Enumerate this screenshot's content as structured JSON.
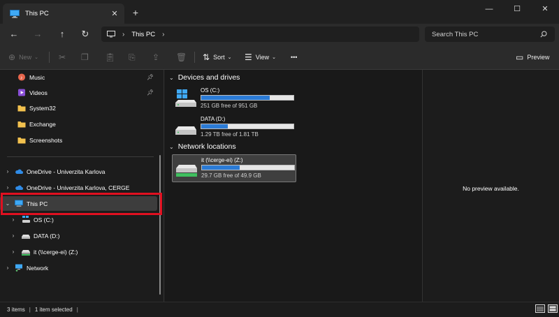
{
  "tab": {
    "title": "This PC",
    "close": "✕",
    "new_tab": "+"
  },
  "window_controls": {
    "minimize": "—",
    "maximize": "☐",
    "close": "✕"
  },
  "nav": {
    "back": "←",
    "forward": "→",
    "up": "↑",
    "refresh": "↻"
  },
  "address": {
    "separator": "›",
    "crumb": "This PC"
  },
  "search": {
    "placeholder": "Search This PC",
    "icon": "search-icon"
  },
  "toolbar": {
    "new_label": "New",
    "sort_label": "Sort",
    "view_label": "View",
    "more": "•••",
    "preview_label": "Preview"
  },
  "sidebar": {
    "quick_access": [
      {
        "label": "Music",
        "pinned": true,
        "icon": "music-icon"
      },
      {
        "label": "Videos",
        "pinned": true,
        "icon": "videos-icon"
      },
      {
        "label": "System32",
        "pinned": false,
        "icon": "folder-icon"
      },
      {
        "label": "Exchange",
        "pinned": false,
        "icon": "folder-icon"
      },
      {
        "label": "Screenshots",
        "pinned": false,
        "icon": "folder-icon"
      }
    ],
    "onedrive": [
      {
        "label": "OneDrive - Univerzita Karlova"
      },
      {
        "label": "OneDrive - Univerzita Karlova, CERGE"
      }
    ],
    "this_pc": {
      "label": "This PC"
    },
    "drives": [
      {
        "label": "OS (C:)"
      },
      {
        "label": "DATA (D:)"
      },
      {
        "label": "it (\\\\cerge-ei) (Z:)"
      }
    ],
    "network": {
      "label": "Network"
    }
  },
  "main": {
    "devices_header": "Devices and drives",
    "network_header": "Network locations",
    "drives": [
      {
        "name": "OS (C:)",
        "free": "251 GB free of 951 GB",
        "used_fraction": 0.74
      },
      {
        "name": "DATA (D:)",
        "free": "1.29 TB free of 1.81 TB",
        "used_fraction": 0.29
      },
      {
        "name": "it (\\\\cerge-ei) (Z:)",
        "free": "29.7 GB free of 49.9 GB",
        "used_fraction": 0.41
      }
    ]
  },
  "preview": {
    "empty_text": "No preview available."
  },
  "status": {
    "items": "3 items",
    "selected": "1 item selected",
    "sep": "|"
  },
  "colors": {
    "accent": "#2b7bd6",
    "highlight": "#e01020",
    "background": "#1c1c1c"
  }
}
